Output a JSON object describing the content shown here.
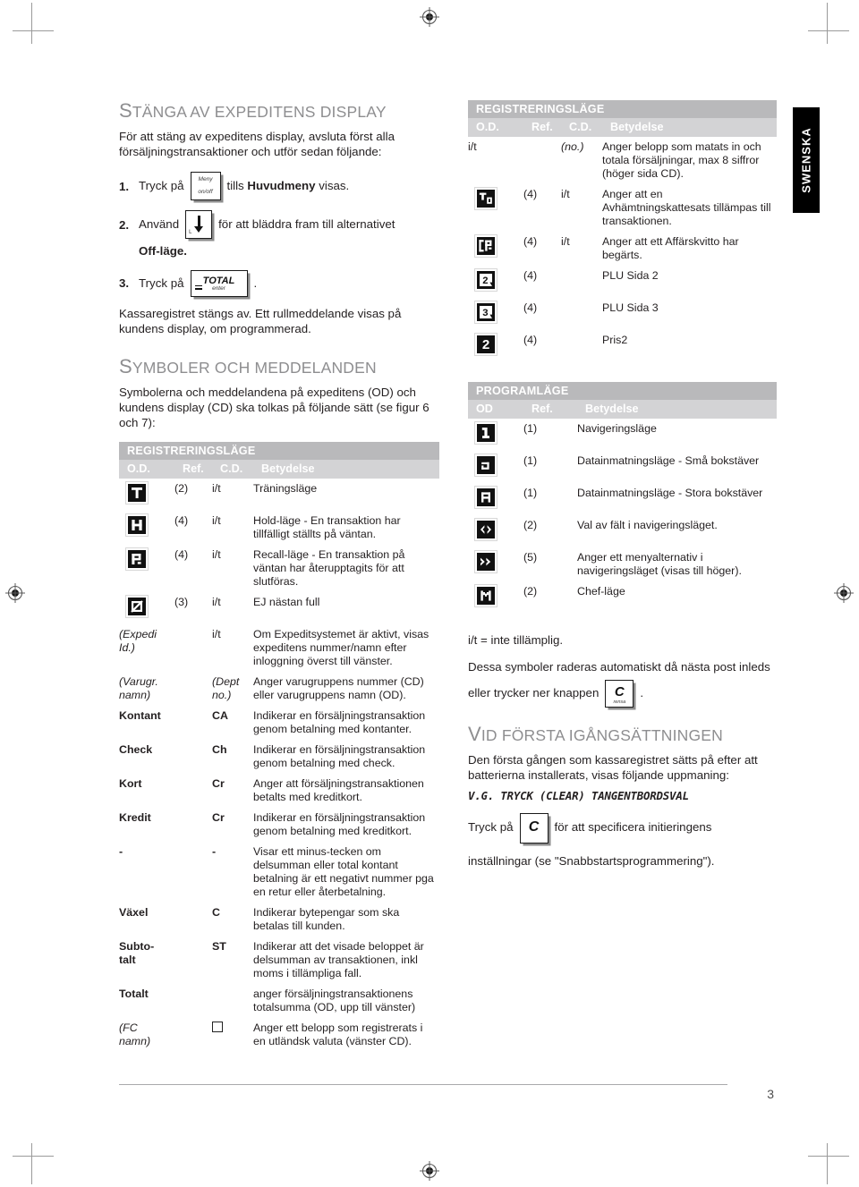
{
  "page": {
    "number": "3",
    "language_tab": "SWENSKA"
  },
  "left_column": {
    "section1": {
      "heading_first": "S",
      "heading_rest": "TÄNGA AV EXPEDITENS DISPLAY",
      "intro": "För att stäng av expeditens display, avsluta först alla försäljningstransaktioner och utför sedan följande:",
      "steps": [
        {
          "num": "1.",
          "pre": "Tryck på",
          "key": {
            "type": "meny",
            "top": "Meny",
            "bottom": "on/off"
          },
          "post_html": "tills <b>Huvudmeny</b> visas.",
          "post_plain": "tills Huvudmeny visas."
        },
        {
          "num": "2.",
          "pre": "Använd",
          "key": {
            "type": "down-arrow",
            "label": "L"
          },
          "post_plain": "för att bläddra fram till alternativet",
          "sub": "Off-läge."
        },
        {
          "num": "3.",
          "pre": "Tryck på",
          "key": {
            "type": "total",
            "big": "TOTAL",
            "small": "enter"
          },
          "post_plain": "."
        }
      ],
      "after_steps": "Kassaregistret stängs av. Ett rullmeddelande visas på kundens display, om programmerad."
    },
    "section2": {
      "heading_first": "S",
      "heading_rest": "YMBOLER OCH MEDDELANDEN",
      "intro": "Symbolerna och meddelandena på expeditens (OD) och kundens display (CD) ska tolkas på följande sätt (se figur 6 och 7):"
    },
    "table": {
      "title": "REGISTRERINGSLÄGE",
      "headers": [
        "O.D.",
        "Ref.",
        "C.D.",
        "Betydelse"
      ],
      "rows": [
        {
          "symbol": "lcd-T",
          "sym_text": "",
          "ref": "(2)",
          "cd": "i/t",
          "desc": "Träningsläge"
        },
        {
          "symbol": "lcd-H",
          "sym_text": "",
          "ref": "(4)",
          "cd": "i/t",
          "desc": "Hold-läge - En transaktion har tillfälligt ställts på väntan."
        },
        {
          "symbol": "lcd-R",
          "sym_text": "",
          "ref": "(4)",
          "cd": "i/t",
          "desc": "Recall-läge - En transaktion på väntan har återupptagits för att slutföras."
        },
        {
          "symbol": "lcd-EJ",
          "sym_text": "",
          "ref": "(3)",
          "cd": "i/t",
          "desc": "EJ nästan full"
        },
        {
          "symbol": "",
          "sym_text": "(Expedi Id.)",
          "sym_style": "ital",
          "ref": "",
          "cd": "i/t",
          "desc": "Om Expeditsystemet är aktivt, visas expeditens nummer/namn efter inloggning överst till vänster."
        },
        {
          "symbol": "",
          "sym_text": "(Varugr. namn)",
          "sym_style": "ital",
          "ref": "",
          "cd": "(Dept no.)",
          "cd_style": "ital",
          "desc": "Anger varugruppens nummer (CD) eller varugruppens namn (OD)."
        },
        {
          "symbol": "",
          "sym_text": "Kontant",
          "sym_style": "bold",
          "ref": "",
          "cd": "CA",
          "cd_style": "bold",
          "desc": "Indikerar en försäljningstransaktion genom betalning med kontanter."
        },
        {
          "symbol": "",
          "sym_text": "Check",
          "sym_style": "bold",
          "ref": "",
          "cd": "Ch",
          "cd_style": "bold",
          "desc": "Indikerar en försäljningstransaktion genom betalning med check."
        },
        {
          "symbol": "",
          "sym_text": "Kort",
          "sym_style": "bold",
          "ref": "",
          "cd": "Cr",
          "cd_style": "bold",
          "desc": "Anger att försäljningstransaktionen betalts med kreditkort."
        },
        {
          "symbol": "",
          "sym_text": "Kredit",
          "sym_style": "bold",
          "ref": "",
          "cd": "Cr",
          "cd_style": "bold",
          "desc": "Indikerar en försäljningstransaktion genom betalning med kreditkort."
        },
        {
          "symbol": "",
          "sym_text": "-",
          "sym_style": "bold",
          "ref": "",
          "cd": "-",
          "cd_style": "bold",
          "desc": "Visar ett minus-tecken om delsumman eller total kontant betalning är ett negativt nummer pga en retur eller återbetalning."
        },
        {
          "symbol": "",
          "sym_text": "Växel",
          "sym_style": "bold",
          "ref": "",
          "cd": "C",
          "cd_style": "bold",
          "desc": "Indikerar bytepengar som ska betalas till kunden."
        },
        {
          "symbol": "",
          "sym_text": "Subto- talt",
          "sym_style": "bold",
          "ref": "",
          "cd": "ST",
          "cd_style": "bold",
          "desc": "Indikerar att det visade beloppet är delsumman av transaktionen, inkl moms i tillämpliga fall."
        },
        {
          "symbol": "",
          "sym_text": "Totalt",
          "sym_style": "bold",
          "ref": "",
          "cd": "",
          "desc": "anger försäljningstransaktionens totalsumma (OD, upp till vänster)"
        },
        {
          "symbol": "square",
          "sym_text": "(FC namn)",
          "sym_style": "ital",
          "ref": "",
          "cd": "",
          "desc": "Anger ett belopp som registrerats i en utländsk valuta (vänster CD)."
        }
      ]
    }
  },
  "right_column": {
    "table_reg": {
      "title": "REGISTRERINGSLÄGE",
      "headers": [
        "O.D.",
        "Ref.",
        "C.D.",
        "Betydelse"
      ],
      "rows": [
        {
          "symbol": "",
          "sym_text": "i/t",
          "ref": "",
          "cd": "(no.)",
          "cd_style": "ital",
          "desc": "Anger belopp som matats in och totala försäljningar, max 8 siffror (höger sida CD)."
        },
        {
          "symbol": "lcd-TO",
          "sym_text": "",
          "ref": "(4)",
          "cd": "i/t",
          "desc": "Anger att en Avhämtningskattesats tillämpas till transaktionen."
        },
        {
          "symbol": "lcd-GR",
          "sym_text": "",
          "ref": "(4)",
          "cd": "i/t",
          "desc": "Anger att ett Affärskvitto har begärts."
        },
        {
          "symbol": "lcd-P2",
          "sym_text": "",
          "ref": "(4)",
          "cd": "",
          "desc": "PLU Sida 2"
        },
        {
          "symbol": "lcd-P3",
          "sym_text": "",
          "ref": "(4)",
          "cd": "",
          "desc": "PLU Sida 3"
        },
        {
          "symbol": "lcd-2b",
          "sym_text": "",
          "ref": "(4)",
          "cd": "",
          "desc": "Pris2"
        }
      ]
    },
    "table_prog": {
      "title": "PROGRAMLÄGE",
      "headers": [
        "OD",
        "Ref.",
        "Betydelse"
      ],
      "rows": [
        {
          "symbol": "lcd-1",
          "ref": "(1)",
          "desc": "Navigeringsläge"
        },
        {
          "symbol": "lcd-alow",
          "ref": "(1)",
          "desc": "Datainmatningsläge - Små bokstäver"
        },
        {
          "symbol": "lcd-aup",
          "ref": "(1)",
          "desc": "Datainmatningsläge - Stora bokstäver"
        },
        {
          "symbol": "lcd-arrows",
          "ref": "(2)",
          "desc": "Val av fält i navigeringsläget."
        },
        {
          "symbol": "lcd-chev",
          "ref": "(5)",
          "desc": "Anger ett menyalternativ i navigeringsläget (visas till höger)."
        },
        {
          "symbol": "lcd-M",
          "ref": "(2)",
          "desc": "Chef-läge"
        }
      ]
    },
    "note_na": "i/t = inte tillämplig.",
    "note_clear_pre": "Dessa symboler raderas automatiskt då nästa post inleds",
    "note_clear_line2_pre": "eller trycker ner knappen",
    "note_clear_key": {
      "type": "c",
      "letter": "C",
      "small": "rensa"
    },
    "note_clear_post": ".",
    "section3": {
      "heading_first": "V",
      "heading_rest": "ID FÖRSTA IGÅNGSÄTTNINGEN",
      "intro": "Den första gången som kassaregistret sätts på efter att batterierna installerats, visas följande uppmaning:",
      "prompt": "V.G. TRYCK (CLEAR) TANGENTBORDSVAL",
      "press_pre": "Tryck på",
      "press_key": {
        "type": "c2",
        "letter": "C"
      },
      "press_post": "för att specificera initieringens",
      "press_tail": "inställningar (se \"Snabbstartsprogrammering\")."
    }
  },
  "colors": {
    "bar": "#b9b9bb",
    "header": "#d3d3d5",
    "heading_gray": "#8e8e90",
    "text": "#231f20",
    "tab_bg": "#000000"
  }
}
